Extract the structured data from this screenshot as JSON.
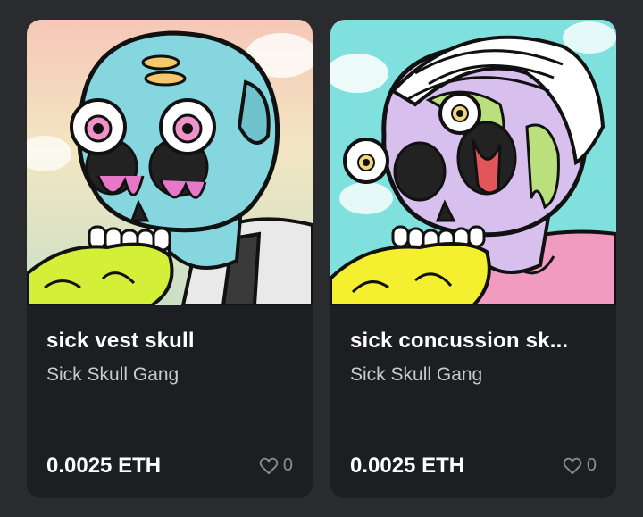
{
  "cards": [
    {
      "title": "sick vest skull",
      "collection": "Sick Skull Gang",
      "price": "0.0025 ETH",
      "likes": "0",
      "image_icon": "blue-skull-vest-art"
    },
    {
      "title": "sick concussion sk...",
      "collection": "Sick Skull Gang",
      "price": "0.0025 ETH",
      "likes": "0",
      "image_icon": "purple-skull-bandage-art"
    }
  ],
  "colors": {
    "background": "#2a2b2f",
    "card": "#1d1e22",
    "title": "#ffffff",
    "subtitle": "#c9cacd",
    "muted": "#8c8d92"
  }
}
